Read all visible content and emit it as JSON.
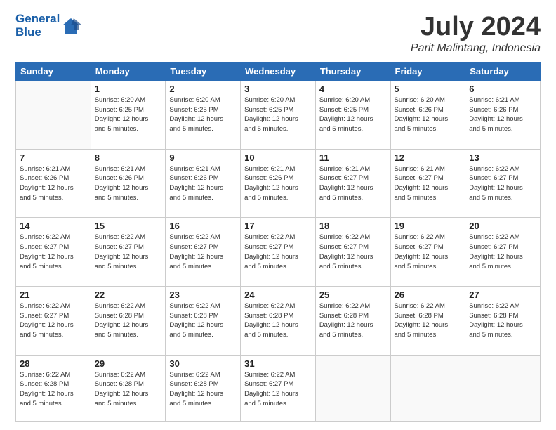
{
  "header": {
    "logo_line1": "General",
    "logo_line2": "Blue",
    "month": "July 2024",
    "location": "Parit Malintang, Indonesia"
  },
  "columns": [
    "Sunday",
    "Monday",
    "Tuesday",
    "Wednesday",
    "Thursday",
    "Friday",
    "Saturday"
  ],
  "weeks": [
    [
      {
        "day": "",
        "info": ""
      },
      {
        "day": "1",
        "info": "Sunrise: 6:20 AM\nSunset: 6:25 PM\nDaylight: 12 hours\nand 5 minutes."
      },
      {
        "day": "2",
        "info": "Sunrise: 6:20 AM\nSunset: 6:25 PM\nDaylight: 12 hours\nand 5 minutes."
      },
      {
        "day": "3",
        "info": "Sunrise: 6:20 AM\nSunset: 6:25 PM\nDaylight: 12 hours\nand 5 minutes."
      },
      {
        "day": "4",
        "info": "Sunrise: 6:20 AM\nSunset: 6:25 PM\nDaylight: 12 hours\nand 5 minutes."
      },
      {
        "day": "5",
        "info": "Sunrise: 6:20 AM\nSunset: 6:26 PM\nDaylight: 12 hours\nand 5 minutes."
      },
      {
        "day": "6",
        "info": "Sunrise: 6:21 AM\nSunset: 6:26 PM\nDaylight: 12 hours\nand 5 minutes."
      }
    ],
    [
      {
        "day": "7",
        "info": "Sunrise: 6:21 AM\nSunset: 6:26 PM\nDaylight: 12 hours\nand 5 minutes."
      },
      {
        "day": "8",
        "info": "Sunrise: 6:21 AM\nSunset: 6:26 PM\nDaylight: 12 hours\nand 5 minutes."
      },
      {
        "day": "9",
        "info": "Sunrise: 6:21 AM\nSunset: 6:26 PM\nDaylight: 12 hours\nand 5 minutes."
      },
      {
        "day": "10",
        "info": "Sunrise: 6:21 AM\nSunset: 6:26 PM\nDaylight: 12 hours\nand 5 minutes."
      },
      {
        "day": "11",
        "info": "Sunrise: 6:21 AM\nSunset: 6:27 PM\nDaylight: 12 hours\nand 5 minutes."
      },
      {
        "day": "12",
        "info": "Sunrise: 6:21 AM\nSunset: 6:27 PM\nDaylight: 12 hours\nand 5 minutes."
      },
      {
        "day": "13",
        "info": "Sunrise: 6:22 AM\nSunset: 6:27 PM\nDaylight: 12 hours\nand 5 minutes."
      }
    ],
    [
      {
        "day": "14",
        "info": "Sunrise: 6:22 AM\nSunset: 6:27 PM\nDaylight: 12 hours\nand 5 minutes."
      },
      {
        "day": "15",
        "info": "Sunrise: 6:22 AM\nSunset: 6:27 PM\nDaylight: 12 hours\nand 5 minutes."
      },
      {
        "day": "16",
        "info": "Sunrise: 6:22 AM\nSunset: 6:27 PM\nDaylight: 12 hours\nand 5 minutes."
      },
      {
        "day": "17",
        "info": "Sunrise: 6:22 AM\nSunset: 6:27 PM\nDaylight: 12 hours\nand 5 minutes."
      },
      {
        "day": "18",
        "info": "Sunrise: 6:22 AM\nSunset: 6:27 PM\nDaylight: 12 hours\nand 5 minutes."
      },
      {
        "day": "19",
        "info": "Sunrise: 6:22 AM\nSunset: 6:27 PM\nDaylight: 12 hours\nand 5 minutes."
      },
      {
        "day": "20",
        "info": "Sunrise: 6:22 AM\nSunset: 6:27 PM\nDaylight: 12 hours\nand 5 minutes."
      }
    ],
    [
      {
        "day": "21",
        "info": "Sunrise: 6:22 AM\nSunset: 6:27 PM\nDaylight: 12 hours\nand 5 minutes."
      },
      {
        "day": "22",
        "info": "Sunrise: 6:22 AM\nSunset: 6:28 PM\nDaylight: 12 hours\nand 5 minutes."
      },
      {
        "day": "23",
        "info": "Sunrise: 6:22 AM\nSunset: 6:28 PM\nDaylight: 12 hours\nand 5 minutes."
      },
      {
        "day": "24",
        "info": "Sunrise: 6:22 AM\nSunset: 6:28 PM\nDaylight: 12 hours\nand 5 minutes."
      },
      {
        "day": "25",
        "info": "Sunrise: 6:22 AM\nSunset: 6:28 PM\nDaylight: 12 hours\nand 5 minutes."
      },
      {
        "day": "26",
        "info": "Sunrise: 6:22 AM\nSunset: 6:28 PM\nDaylight: 12 hours\nand 5 minutes."
      },
      {
        "day": "27",
        "info": "Sunrise: 6:22 AM\nSunset: 6:28 PM\nDaylight: 12 hours\nand 5 minutes."
      }
    ],
    [
      {
        "day": "28",
        "info": "Sunrise: 6:22 AM\nSunset: 6:28 PM\nDaylight: 12 hours\nand 5 minutes."
      },
      {
        "day": "29",
        "info": "Sunrise: 6:22 AM\nSunset: 6:28 PM\nDaylight: 12 hours\nand 5 minutes."
      },
      {
        "day": "30",
        "info": "Sunrise: 6:22 AM\nSunset: 6:28 PM\nDaylight: 12 hours\nand 5 minutes."
      },
      {
        "day": "31",
        "info": "Sunrise: 6:22 AM\nSunset: 6:27 PM\nDaylight: 12 hours\nand 5 minutes."
      },
      {
        "day": "",
        "info": ""
      },
      {
        "day": "",
        "info": ""
      },
      {
        "day": "",
        "info": ""
      }
    ]
  ]
}
